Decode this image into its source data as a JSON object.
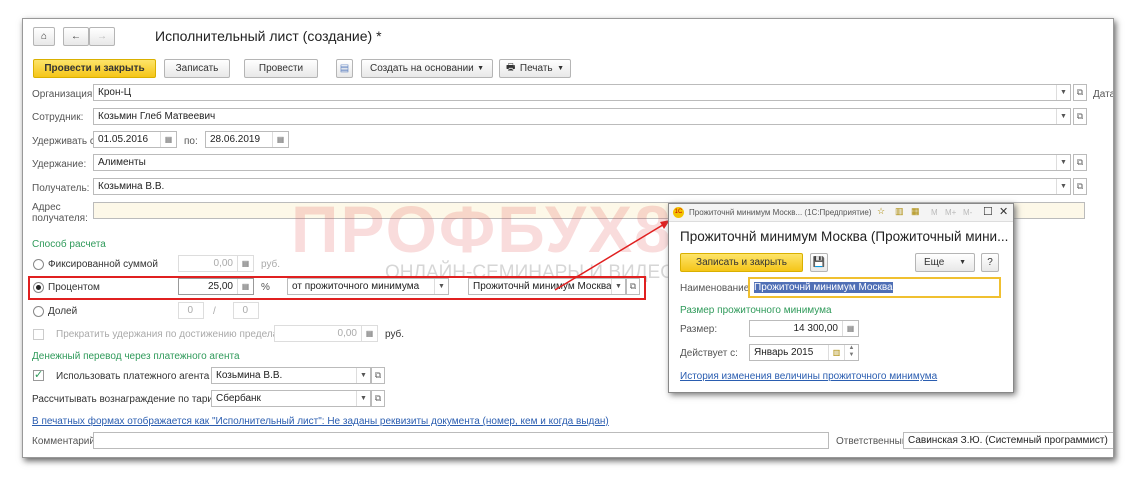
{
  "title": "Исполнительный лист (создание) *",
  "toolbar": {
    "post_close": "Провести и закрыть",
    "save": "Записать",
    "post": "Провести",
    "create_based": "Создать на основании",
    "print": "Печать"
  },
  "fields": {
    "org_label": "Организация:",
    "org": "Крон-Ц",
    "date_label": "Дата:",
    "emp_label": "Сотрудник:",
    "emp": "Козьмин Глеб Матвеевич",
    "from_label": "Удерживать с:",
    "from": "01.05.2016",
    "to_label": "по:",
    "to": "28.06.2019",
    "ded_label": "Удержание:",
    "ded": "Алименты",
    "rec_label": "Получатель:",
    "rec": "Козьмина В.В.",
    "addr_label": "Адрес получателя:",
    "addr": ""
  },
  "calc": {
    "section": "Способ расчета",
    "fixed_label": "Фиксированной суммой",
    "fixed_value": "0,00",
    "rub": "руб.",
    "percent_label": "Процентом",
    "percent_value": "25,00",
    "pct": "%",
    "percent_base": "от прожиточного минимума",
    "percent_min": "Прожиточнй минимум Москва",
    "share_label": "Долей",
    "share_num": "0",
    "slash": "/",
    "share_den": "0",
    "limit_label": "Прекратить удержания по достижению предела",
    "limit_value": "0,00",
    "limit_rub": "руб."
  },
  "agent": {
    "section": "Денежный перевод через платежного агента",
    "use_label": "Использовать платежного агента",
    "use_value": "Козьмина В.В.",
    "tariff_label": "Рассчитывать вознаграждение по тарифу:",
    "tariff_value": "Сбербанк"
  },
  "footer": {
    "link": "В печатных формах отображается как \"Исполнительный лист\": Не заданы реквизиты документа (номер, кем и когда выдан)",
    "comment_label": "Комментарий:",
    "comment": "",
    "resp_label": "Ответственный:",
    "resp": "Савинская З.Ю. (Системный программист)"
  },
  "dialog": {
    "window_title": "Прожиточнй минимум Москв...  (1С:Предприятие)",
    "win_btns": [
      "M",
      "M+",
      "M-"
    ],
    "title": "Прожиточнй минимум Москва (Прожиточный мини...",
    "save_close": "Записать и закрыть",
    "more": "Еще",
    "help": "?",
    "name_label": "Наименование:",
    "name": "Прожиточнй минимум Москва",
    "section": "Размер прожиточного минимума",
    "size_label": "Размер:",
    "size": "14 300,00",
    "valid_label": "Действует с:",
    "valid": "Январь 2015",
    "history": "История изменения величины прожиточного минимума"
  },
  "watermark": {
    "brand": "ПРОФБУХ8.РУ",
    "tagline": "ОНЛАЙН-СЕМИНАРЫ И ВИДЕОКУРСЫ 1С:8"
  },
  "colors": {
    "accent_yellow": "#f5c518",
    "green": "#2f9a5a",
    "highlight": "#e02020",
    "link": "#2a5db0"
  }
}
